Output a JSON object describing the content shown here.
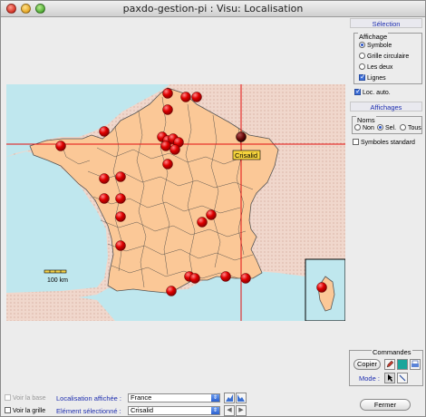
{
  "window": {
    "title": "paxdo-gestion-pi : Visu: Localisation"
  },
  "selection": {
    "header": "Sélection",
    "affichage_title": "Affichage",
    "options": [
      {
        "label": "Symbole",
        "selected": true
      },
      {
        "label": "Grille circulaire",
        "selected": false
      },
      {
        "label": "Les deux",
        "selected": false
      }
    ],
    "lignes": {
      "label": "Lignes",
      "checked": true
    },
    "loc_auto": {
      "label": "Loc. auto.",
      "checked": true
    }
  },
  "affichages": {
    "header": "Affichages",
    "noms_title": "Noms",
    "noms_options": [
      {
        "label": "Non",
        "selected": false
      },
      {
        "label": "Sel.",
        "selected": true
      },
      {
        "label": "Tous",
        "selected": false
      }
    ],
    "symboles_standard": {
      "label": "Symboles standard",
      "checked": false
    }
  },
  "map": {
    "scale_label": "100 km",
    "selected_label": "Crisalid",
    "colors": {
      "land": "#fbc897",
      "sea": "#bfe7ee",
      "foreign": "#f0d7cc",
      "marker": "#e00000",
      "crosshair": "#e31010"
    }
  },
  "commandes": {
    "header": "Commandes",
    "copier": "Copier",
    "mode_label": "Mode :"
  },
  "bottom": {
    "voir_base": "Voir la base",
    "voir_grille": "Voir la grille",
    "localisation_label": "Localisation affichée :",
    "localisation_value": "France",
    "element_label": "Elément sélectionné :",
    "element_value": "Crisalid",
    "fermer": "Fermer"
  }
}
